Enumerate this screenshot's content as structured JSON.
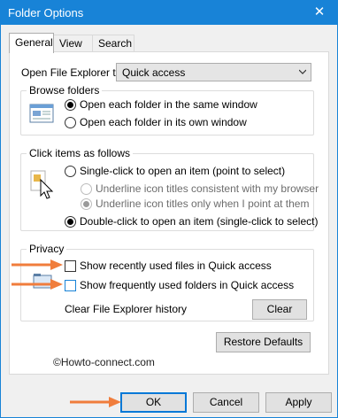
{
  "window": {
    "title": "Folder Options",
    "close_glyph": "✕"
  },
  "tabs": [
    "General",
    "View",
    "Search"
  ],
  "open_explorer": {
    "label": "Open File Explorer to:",
    "value": "Quick access"
  },
  "browse_folders": {
    "legend": "Browse folders",
    "options": [
      "Open each folder in the same window",
      "Open each folder in its own window"
    ],
    "selected": 0
  },
  "click_items": {
    "legend": "Click items as follows",
    "single": "Single-click to open an item (point to select)",
    "underline_browser": "Underline icon titles consistent with my browser",
    "underline_point": "Underline icon titles only when I point at them",
    "double": "Double-click to open an item (single-click to select)"
  },
  "privacy": {
    "legend": "Privacy",
    "recent_files": "Show recently used files in Quick access",
    "frequent_folders": "Show frequently used folders in Quick access",
    "clear_history": "Clear File Explorer history",
    "clear_button": "Clear"
  },
  "restore_defaults": "Restore Defaults",
  "watermark": "©Howto-connect.com",
  "buttons": {
    "ok": "OK",
    "cancel": "Cancel",
    "apply": "Apply"
  },
  "colors": {
    "titlebar": "#1883d7",
    "annotation_arrow": "#f07d3c"
  }
}
